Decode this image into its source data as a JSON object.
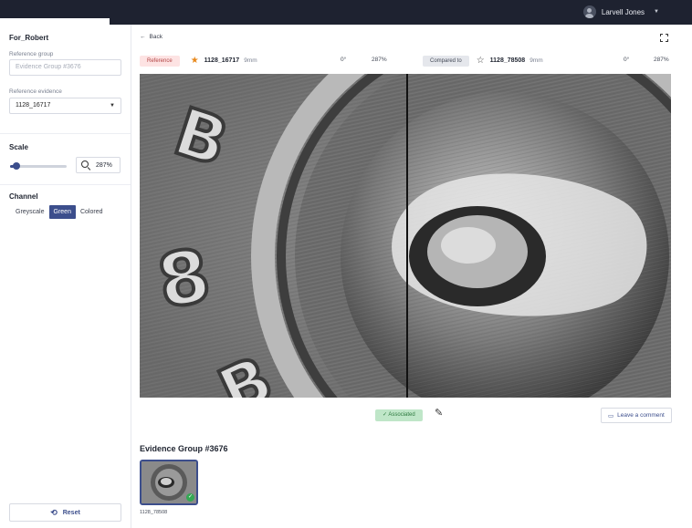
{
  "header": {
    "user_name": "Larvell Jones",
    "user_menu_icon": "chevron-down-icon",
    "avatar_icon": "user-avatar-icon"
  },
  "sidebar": {
    "case_title": "For_Robert",
    "reference_group_label": "Reference group",
    "reference_group_placeholder": "Evidence Group #3676",
    "reference_evidence_label": "Reference evidence",
    "reference_evidence_value": "1128_16717",
    "scale_title": "Scale",
    "scale_value": 0.12,
    "zoom_value": "287%",
    "channel_title": "Channel",
    "channels": [
      "Greyscale",
      "Green",
      "Colored"
    ],
    "active_channel": "Green",
    "reset_label": "Reset"
  },
  "main": {
    "back_label": "Back",
    "reference": {
      "tag": "Reference",
      "id": "1128_16717",
      "size": "9mm",
      "rotation": "0°",
      "zoom": "287%",
      "starred": true
    },
    "compared": {
      "tag": "Compared to",
      "id": "1128_78508",
      "size": "9mm",
      "rotation": "0°",
      "zoom": "287%",
      "starred": false
    },
    "association_status": "Associated",
    "comment_label": "Leave a comment",
    "group_title": "Evidence Group #3676",
    "thumbnail_label": "1128_78508"
  },
  "colors": {
    "primary": "#3c4e8c",
    "reference_tag_bg": "#fde3e3",
    "associated_bg": "#bfe6c8",
    "star_active": "#e8891c"
  }
}
